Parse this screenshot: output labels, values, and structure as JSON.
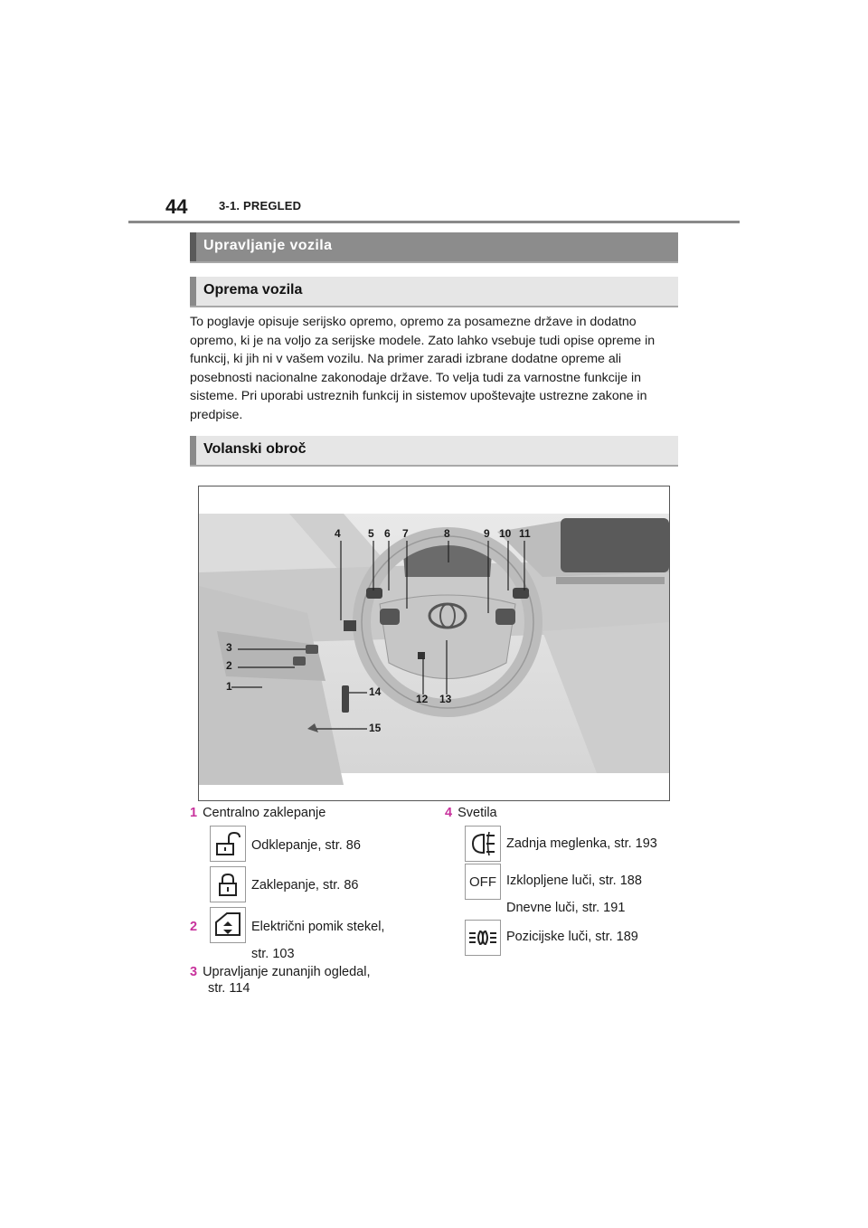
{
  "header": {
    "page_number": "44",
    "section": "3-1. PREGLED"
  },
  "headings": {
    "main": "Upravljanje vozila",
    "equipment": "Oprema vozila",
    "steering": "Volanski obroč"
  },
  "intro_text": "To poglavje opisuje serijsko opremo, opremo za posamezne države in dodatno opremo, ki je na voljo za serijske modele. Zato lahko vsebuje tudi opise opreme in funkcij, ki jih ni v vašem vozilu. Na primer zaradi izbrane dodatne opreme ali posebnosti nacionalne zakonodaje države. To velja tudi za varnostne funkcije in sisteme. Pri uporabi ustreznih funkcij in sistemov upoštevajte ustrezne zakone in predpise.",
  "figure": {
    "callouts": [
      "1",
      "2",
      "3",
      "4",
      "5",
      "6",
      "7",
      "8",
      "9",
      "10",
      "11",
      "12",
      "13",
      "14",
      "15"
    ]
  },
  "legend": {
    "item1": {
      "num": "1",
      "label": "Centralno zaklepanje",
      "unlock": "Odklepanje, str. 86",
      "lock": "Zaklepanje, str. 86",
      "unlock_icon": "unlock-icon",
      "lock_icon": "lock-icon"
    },
    "item2": {
      "num": "2",
      "line1": "Električni pomik stekel,",
      "line2": "str. 103",
      "icon": "window-switch-icon"
    },
    "item3": {
      "num": "3",
      "line1": "Upravljanje zunanjih ogledal,",
      "line2": "str. 114"
    },
    "item4": {
      "num": "4",
      "label": "Svetila",
      "fog": "Zadnja meglenka, str. 193",
      "off": "Izklopljene luči, str. 188",
      "drl": "Dnevne luči, str. 191",
      "parking": "Pozicijske luči, str. 189",
      "off_icon_text": "OFF",
      "fog_icon": "rear-fog-icon",
      "parking_icon": "parking-lights-icon"
    },
    "accent_color": "#c8329c"
  }
}
